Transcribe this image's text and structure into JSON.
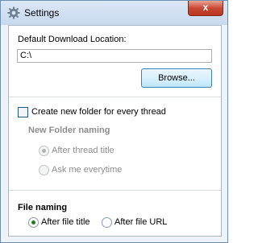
{
  "window": {
    "title": "Settings",
    "close_label": "x",
    "icon": "gear-icon"
  },
  "download": {
    "label": "Default Download Location:",
    "path_value": "C:\\",
    "browse_label": "Browse..."
  },
  "thread": {
    "create_folder_label": "Create new folder for every thread",
    "create_folder_checked": false,
    "naming_heading": "New Folder naming",
    "options": [
      {
        "label": "After thread title",
        "selected": true,
        "enabled": false
      },
      {
        "label": "Ask me everytime",
        "selected": false,
        "enabled": false
      }
    ]
  },
  "file_naming": {
    "heading": "File naming",
    "options": [
      {
        "label": "After file title",
        "selected": true
      },
      {
        "label": "After file URL",
        "selected": false
      }
    ]
  },
  "colors": {
    "accent": "#3c7fb1",
    "selected_radio": "#1e7c1e",
    "disabled_text": "#8d8d8d"
  }
}
